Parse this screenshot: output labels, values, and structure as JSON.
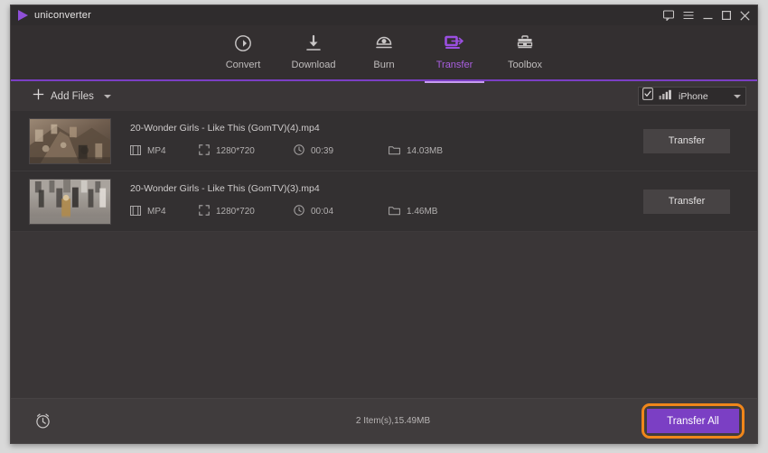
{
  "window": {
    "brand": "uniconverter",
    "controls": [
      {
        "name": "feedback-icon",
        "label": "Feedback"
      },
      {
        "name": "menu-icon",
        "label": "Menu"
      },
      {
        "name": "minimize-icon",
        "label": "Minimize"
      },
      {
        "name": "maximize-icon",
        "label": "Maximize"
      },
      {
        "name": "close-icon",
        "label": "Close"
      }
    ]
  },
  "nav": {
    "active": "Transfer",
    "tabs": [
      {
        "label": "Convert",
        "icon": "convert-icon",
        "active": false
      },
      {
        "label": "Download",
        "icon": "download-icon",
        "active": false
      },
      {
        "label": "Burn",
        "icon": "burn-icon",
        "active": false
      },
      {
        "label": "Transfer",
        "icon": "transfer-icon",
        "active": true
      },
      {
        "label": "Toolbox",
        "icon": "toolbox-icon",
        "active": false
      }
    ]
  },
  "toolbar": {
    "add_files_label": "Add Files",
    "add_files_icon": "plus-icon",
    "device": {
      "name": "iPhone",
      "checkbox_icon": "device-checkbox-icon",
      "signal_icon": "device-signal-icon"
    }
  },
  "files": [
    {
      "name": "20-Wonder Girls - Like This (GomTV)(4).mp4",
      "format": "MP4",
      "resolution": "1280*720",
      "duration": "00:39",
      "size": "14.03MB",
      "action_label": "Transfer",
      "thumb": "escalator-crowd"
    },
    {
      "name": "20-Wonder Girls - Like This (GomTV)(3).mp4",
      "format": "MP4",
      "resolution": "1280*720",
      "duration": "00:04",
      "size": "1.46MB",
      "action_label": "Transfer",
      "thumb": "street-crowd"
    }
  ],
  "footer": {
    "clock_icon": "alarm-clock-icon",
    "status": "2 Item(s),15.49MB",
    "transfer_all_label": "Transfer All"
  },
  "colors": {
    "accent_purple": "#7b3fc4",
    "accent_purple_light": "#a95fe0",
    "highlight_orange": "#f0861a",
    "window_bg": "#3a3637",
    "row_bg": "#333031",
    "titlebar_bg": "#2f2c2d"
  }
}
